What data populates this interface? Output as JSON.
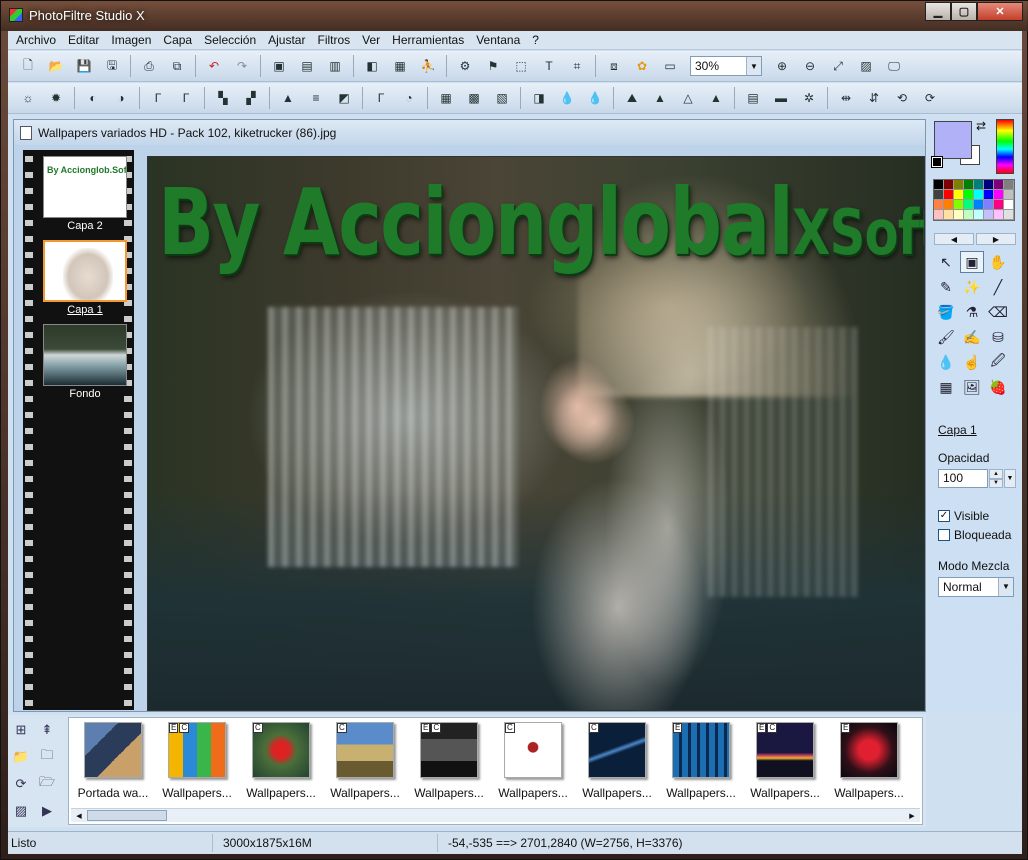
{
  "window": {
    "title": "PhotoFiltre Studio X",
    "minimize": "▁",
    "maximize": "▢",
    "close": "✕"
  },
  "menu": [
    "Archivo",
    "Editar",
    "Imagen",
    "Capa",
    "Selección",
    "Ajustar",
    "Filtros",
    "Ver",
    "Herramientas",
    "Ventana",
    "?"
  ],
  "toolbar": {
    "zoom": "30%"
  },
  "document": {
    "title": "Wallpapers variados HD - Pack 102, kiketrucker (86).jpg",
    "watermark_main": "By Accionglobal",
    "watermark_small": "XSoft",
    "layers": [
      {
        "label": "Capa 2",
        "thumb_text": "By Accionglob.Sof"
      },
      {
        "label": "Capa 1"
      },
      {
        "label": "Fondo"
      }
    ]
  },
  "panel": {
    "fg_color": "#b1b1f7",
    "layer_name": "Capa 1",
    "opacity_label": "Opacidad",
    "opacity_value": "100",
    "visible_label": "Visible",
    "locked_label": "Bloqueada",
    "blend_label": "Modo Mezcla",
    "blend_value": "Normal",
    "palette": [
      "#000000",
      "#7f0000",
      "#7f7f00",
      "#007f00",
      "#007f7f",
      "#00007f",
      "#7f007f",
      "#7f7f7f",
      "#404040",
      "#ff0000",
      "#ffff00",
      "#00ff00",
      "#00ffff",
      "#0000ff",
      "#ff00ff",
      "#c0c0c0",
      "#ff8040",
      "#ff8000",
      "#80ff00",
      "#00ff80",
      "#0080ff",
      "#8080ff",
      "#ff0080",
      "#ffffff",
      "#ffc0c0",
      "#ffe0a0",
      "#ffffc0",
      "#c0ffc0",
      "#c0ffff",
      "#c0c0ff",
      "#ffc0ff",
      "#e0e0e0"
    ]
  },
  "browser": {
    "items": [
      {
        "caption": "Portada wa...",
        "tags": []
      },
      {
        "caption": "Wallpapers...",
        "tags": [
          "E",
          "C"
        ]
      },
      {
        "caption": "Wallpapers...",
        "tags": [
          "C"
        ]
      },
      {
        "caption": "Wallpapers...",
        "tags": [
          "C"
        ]
      },
      {
        "caption": "Wallpapers...",
        "tags": [
          "E",
          "C"
        ]
      },
      {
        "caption": "Wallpapers...",
        "tags": [
          "C"
        ]
      },
      {
        "caption": "Wallpapers...",
        "tags": [
          "C"
        ]
      },
      {
        "caption": "Wallpapers...",
        "tags": [
          "E"
        ]
      },
      {
        "caption": "Wallpapers...",
        "tags": [
          "E",
          "C"
        ]
      },
      {
        "caption": "Wallpapers...",
        "tags": [
          "E"
        ]
      }
    ]
  },
  "status": {
    "state": "Listo",
    "size": "3000x1875x16M",
    "coords": "-54,-535 ==> 2701,2840 (W=2756, H=3376)"
  }
}
